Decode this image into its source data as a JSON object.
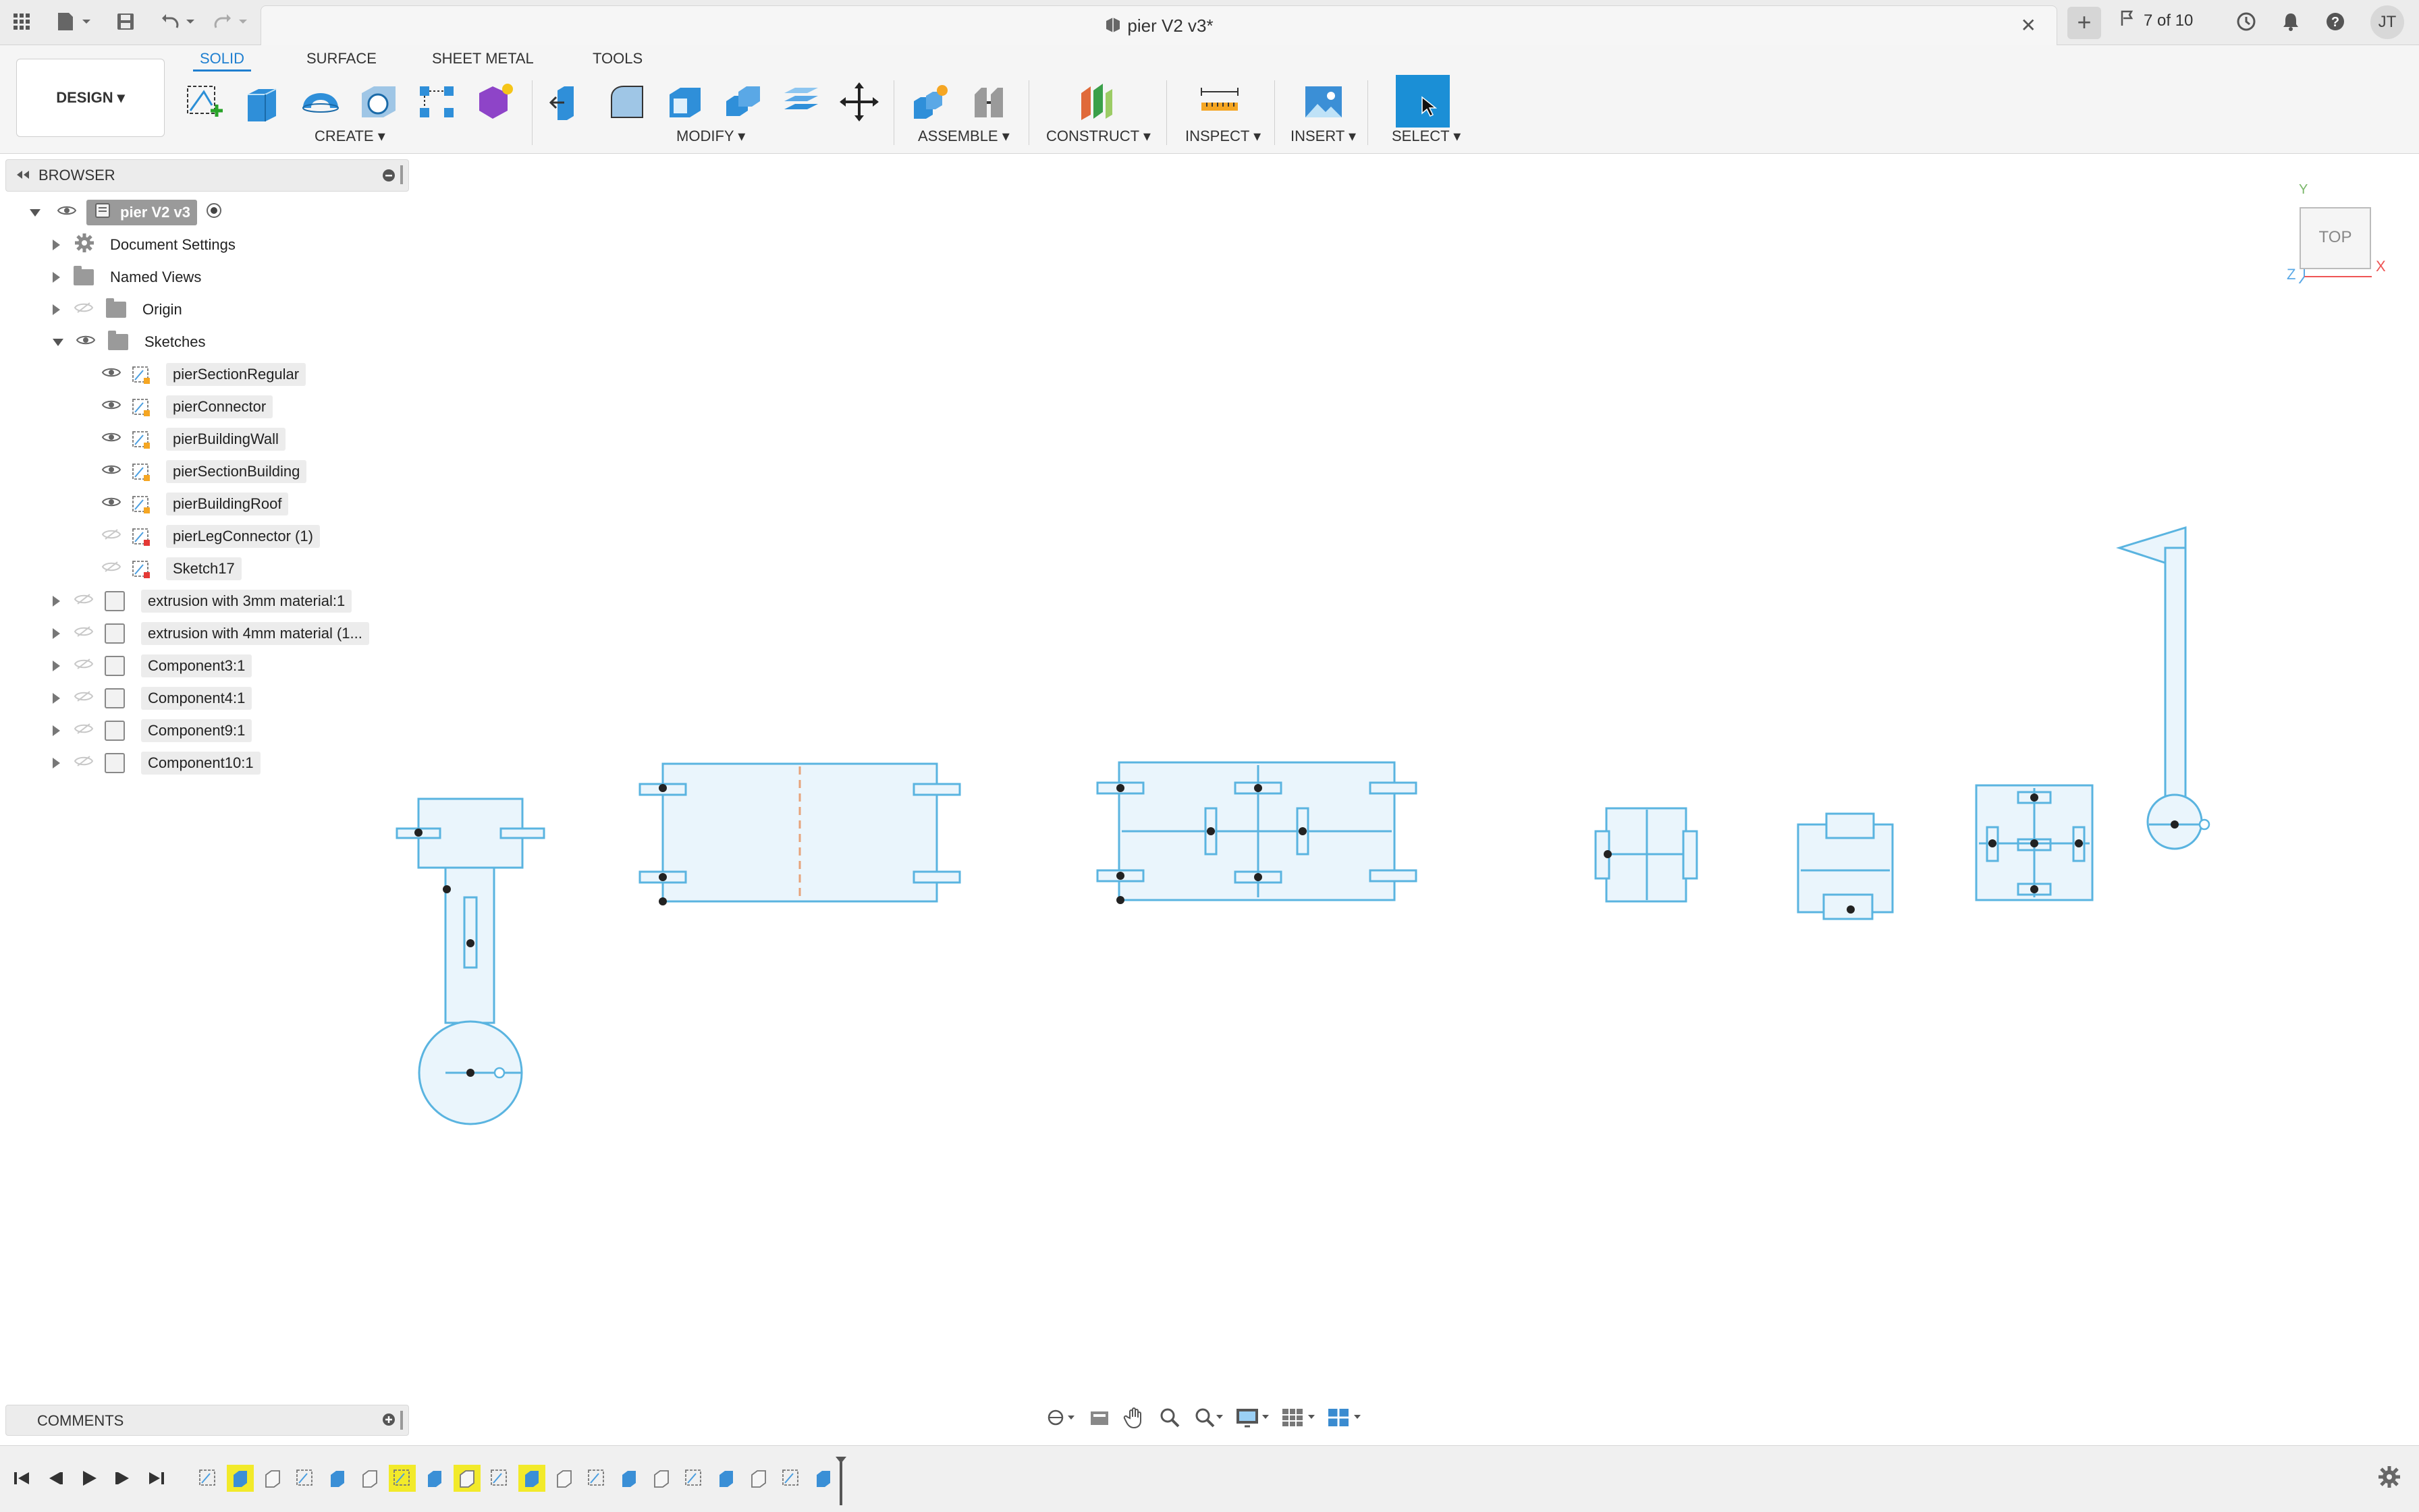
{
  "titlebar": {
    "document_title": "pier V2 v3*",
    "version_label": "7 of 10",
    "user_initials": "JT",
    "icons": [
      "apps-grid-icon",
      "file-icon",
      "save-icon",
      "undo-icon",
      "redo-icon",
      "close-icon",
      "plus-icon",
      "job-status-icon",
      "notification-bell-icon",
      "help-icon"
    ]
  },
  "ribbon": {
    "workspace": "DESIGN",
    "tabs": [
      {
        "label": "SOLID",
        "active": true
      },
      {
        "label": "SURFACE",
        "active": false
      },
      {
        "label": "SHEET METAL",
        "active": false
      },
      {
        "label": "TOOLS",
        "active": false
      }
    ],
    "groups": {
      "create": "CREATE",
      "modify": "MODIFY",
      "assemble": "ASSEMBLE",
      "construct": "CONSTRUCT",
      "inspect": "INSPECT",
      "insert": "INSERT",
      "select": "SELECT"
    },
    "accent_color": "#1f7fd0"
  },
  "browser": {
    "title": "BROWSER",
    "root": "pier V2 v3",
    "items": [
      {
        "label": "Document Settings",
        "icon": "gear-icon"
      },
      {
        "label": "Named Views",
        "icon": "folder-icon"
      },
      {
        "label": "Origin",
        "icon": "folder-icon"
      },
      {
        "label": "Sketches",
        "icon": "folder-icon"
      }
    ],
    "sketches": [
      {
        "label": "pierSectionRegular",
        "visible": true
      },
      {
        "label": "pierConnector",
        "visible": true
      },
      {
        "label": "pierBuildingWall",
        "visible": true
      },
      {
        "label": "pierSectionBuilding",
        "visible": true
      },
      {
        "label": "pierBuildingRoof",
        "visible": true
      },
      {
        "label": "pierLegConnector (1)",
        "visible": false
      },
      {
        "label": "Sketch17",
        "visible": false
      }
    ],
    "components": [
      {
        "label": "extrusion with 3mm material:1"
      },
      {
        "label": "extrusion with 4mm material (1..."
      },
      {
        "label": "Component3:1"
      },
      {
        "label": "Component4:1"
      },
      {
        "label": "Component9:1"
      },
      {
        "label": "Component10:1"
      }
    ]
  },
  "comments": {
    "label": "COMMENTS"
  },
  "viewcube": {
    "face": "TOP",
    "axis_x": "X",
    "axis_y": "Y",
    "axis_z": "Z"
  },
  "timeline": {
    "highlighted_steps": [
      2,
      7,
      9,
      11
    ],
    "step_count": 20
  },
  "sketch_color": "#5ab4e0"
}
